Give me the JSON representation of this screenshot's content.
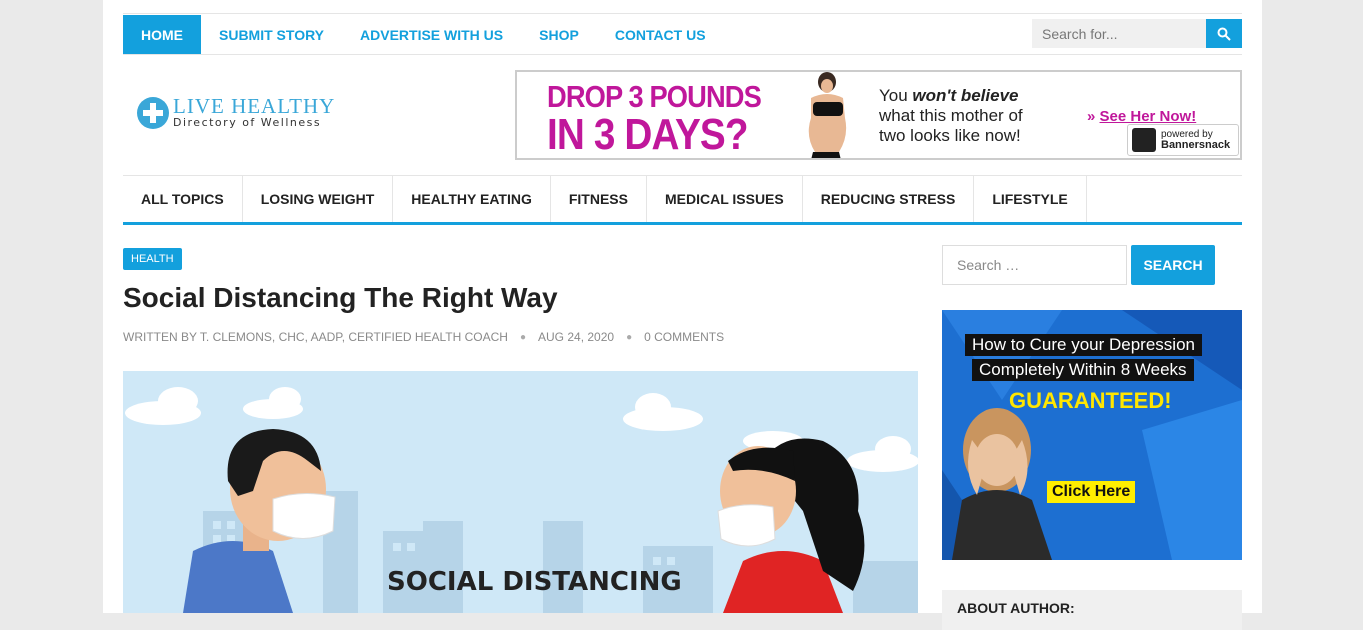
{
  "topnav": {
    "items": [
      "HOME",
      "SUBMIT STORY",
      "ADVERTISE WITH US",
      "SHOP",
      "CONTACT US"
    ],
    "search_placeholder": "Search for...",
    "search_icon": "search-icon"
  },
  "logo": {
    "line1": "LIVE HEALTHY",
    "line2": "Directory of Wellness"
  },
  "banner": {
    "headline_1": "DROP 3 POUNDS",
    "headline_2": "IN 3 DAYS?",
    "text_you": "You ",
    "text_wont": "won't believe",
    "text_line2": "what this mother of",
    "text_line3": "two looks like now!",
    "cta_arrow": "» ",
    "cta": "See Her Now!",
    "powered_by": "powered by",
    "powered_brand": "Bannersnack"
  },
  "mainnav": {
    "items": [
      "ALL TOPICS",
      "LOSING WEIGHT",
      "HEALTHY EATING",
      "FITNESS",
      "MEDICAL ISSUES",
      "REDUCING STRESS",
      "LIFESTYLE"
    ]
  },
  "article": {
    "tag": "HEALTH",
    "title": "Social Distancing The Right Way",
    "author": "WRITTEN BY T. CLEMONS, CHC, AADP, CERTIFIED HEALTH COACH",
    "date": "AUG 24, 2020",
    "comments": "0 COMMENTS",
    "image_caption": "SOCIAL DISTANCING"
  },
  "sidebar": {
    "search_placeholder": "Search …",
    "search_button": "SEARCH",
    "ad_line1": "How to Cure your Depression",
    "ad_line2": "Completely Within 8 Weeks",
    "ad_guarantee": "GUARANTEED!",
    "ad_cta": "Click Here",
    "about_title": "ABOUT AUTHOR:"
  },
  "colors": {
    "accent": "#13a0dd",
    "banner_magenta": "#c0179b",
    "ad_yellow": "#ffee00"
  }
}
